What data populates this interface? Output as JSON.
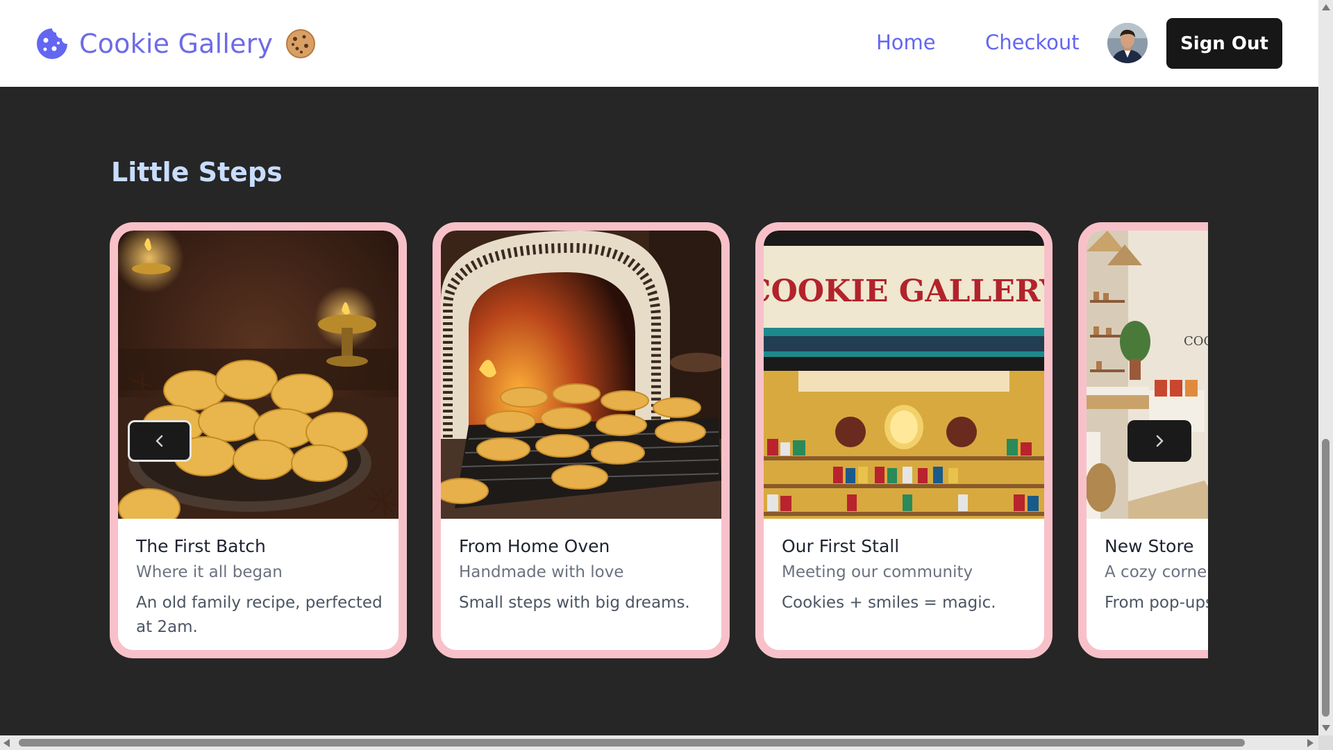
{
  "header": {
    "brand": "Cookie Gallery",
    "brand_emoji": "🍪",
    "nav": [
      {
        "label": "Home"
      },
      {
        "label": "Checkout"
      }
    ],
    "sign_out": "Sign Out"
  },
  "section": {
    "title": "Little Steps"
  },
  "cards": [
    {
      "title": "The First Batch",
      "subtitle": "Where it all began",
      "description": "An old family recipe, perfected at 2am.",
      "image": "cookies-with-diya-lamps"
    },
    {
      "title": "From Home Oven",
      "subtitle": "Handmade with love",
      "description": "Small steps with big dreams.",
      "image": "cookies-by-clay-oven"
    },
    {
      "title": "Our First Stall",
      "subtitle": "Meeting our community",
      "description": "Cookies + smiles = magic.",
      "image": "cookie-gallery-stall",
      "sign_text": "COOKIE GALLERY"
    },
    {
      "title": "New Store",
      "subtitle": "A cozy corner",
      "description": "From pop-ups of our own.",
      "image": "new-store-interior",
      "sign_text": "COO"
    }
  ],
  "icons": {
    "brand": "cookie-icon",
    "prev": "chevron-left-icon",
    "next": "chevron-right-icon"
  },
  "colors": {
    "brand": "#6366f1",
    "card_border": "#f8c1c9",
    "background": "#262626",
    "title": "#c8ddff"
  }
}
